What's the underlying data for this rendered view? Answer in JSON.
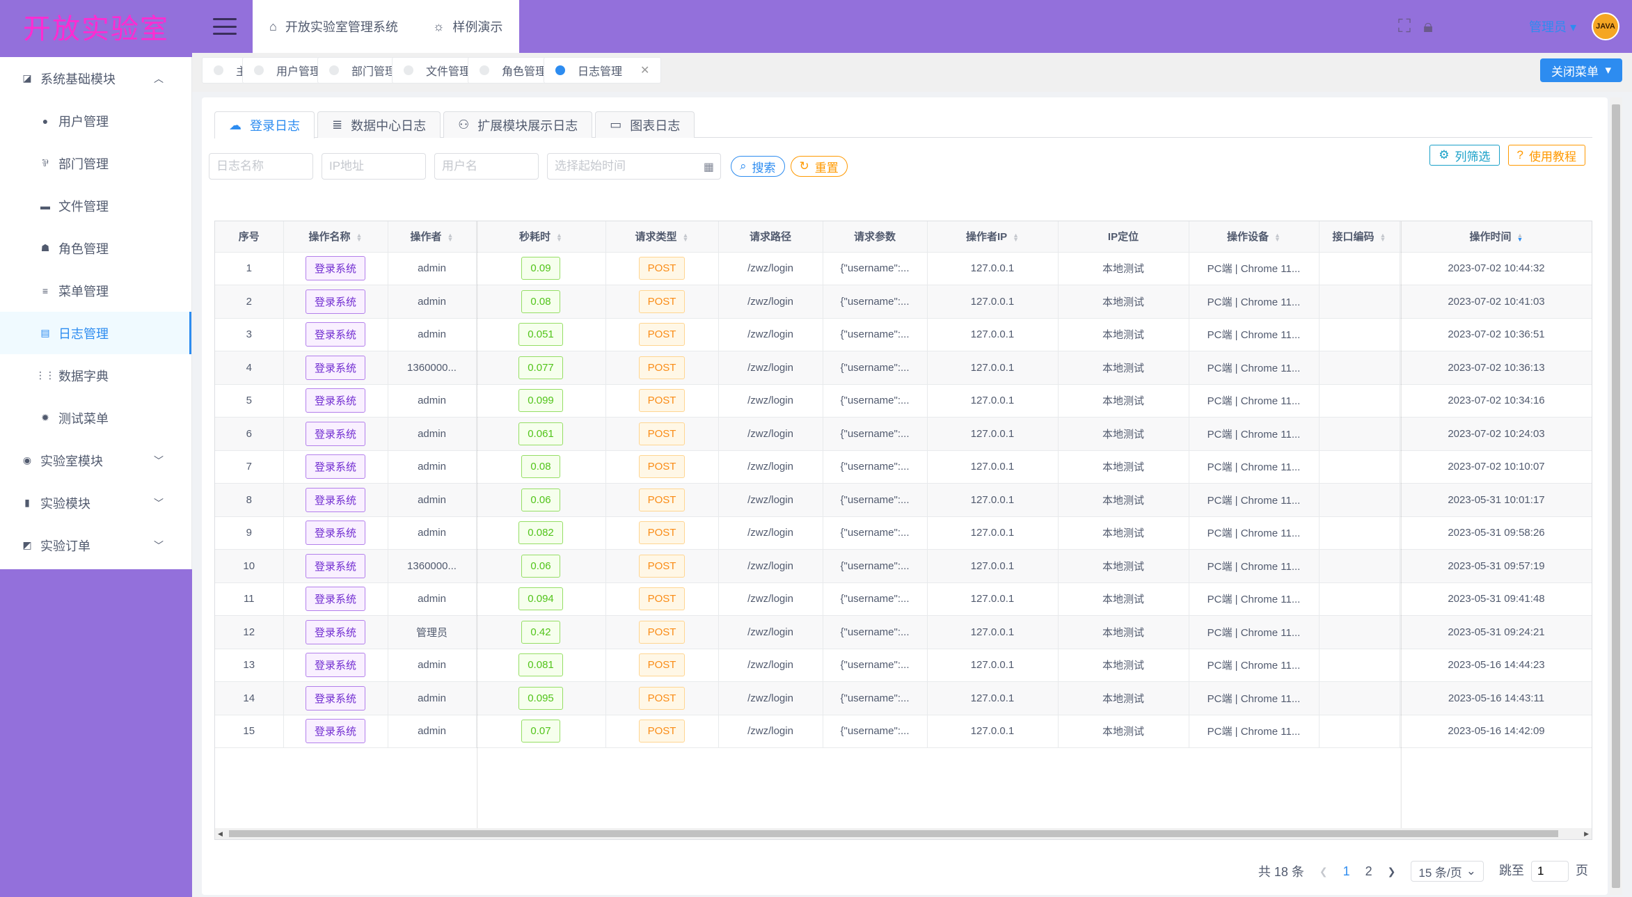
{
  "brand": {
    "logo_text": "开放实验室"
  },
  "header": {
    "nav": [
      {
        "icon": "home-icon",
        "glyph": "⌂",
        "label": "开放实验室管理系统"
      },
      {
        "icon": "bulb-icon",
        "glyph": "☼",
        "label": "样例演示"
      }
    ],
    "username": "管理员",
    "avatar_text": "JAVA"
  },
  "sidebar": {
    "items": [
      {
        "label": "系统基础模块",
        "level": "top",
        "icon": "chart-icon",
        "glyph": "◪",
        "chevron": "︿"
      },
      {
        "label": "用户管理",
        "level": "sub",
        "icon": "user-icon",
        "glyph": "●"
      },
      {
        "label": "部门管理",
        "level": "sub",
        "icon": "department-icon",
        "glyph": "⅌"
      },
      {
        "label": "文件管理",
        "level": "sub",
        "icon": "folder-icon",
        "glyph": "▬"
      },
      {
        "label": "角色管理",
        "level": "sub",
        "icon": "role-icon",
        "glyph": "☗"
      },
      {
        "label": "菜单管理",
        "level": "sub",
        "icon": "menu-icon",
        "glyph": "≡"
      },
      {
        "label": "日志管理",
        "level": "sub",
        "icon": "log-icon",
        "glyph": "▤",
        "active": true
      },
      {
        "label": "数据字典",
        "level": "sub",
        "icon": "grid-icon",
        "glyph": "⋮⋮"
      },
      {
        "label": "测试菜单",
        "level": "sub",
        "icon": "bug-icon",
        "glyph": "✹"
      },
      {
        "label": "实验室模块",
        "level": "top",
        "icon": "lab-icon",
        "glyph": "◉",
        "chevron": "﹀"
      },
      {
        "label": "实验模块",
        "level": "top",
        "icon": "experiment-icon",
        "glyph": "▮",
        "chevron": "﹀"
      },
      {
        "label": "实验订单",
        "level": "top",
        "icon": "order-icon",
        "glyph": "◩",
        "chevron": "﹀"
      }
    ]
  },
  "tags": [
    {
      "label": "主页",
      "closable": false,
      "active": false
    },
    {
      "label": "用户管理",
      "closable": true,
      "active": false
    },
    {
      "label": "部门管理",
      "closable": true,
      "active": false
    },
    {
      "label": "文件管理",
      "closable": true,
      "active": false
    },
    {
      "label": "角色管理",
      "closable": true,
      "active": false
    },
    {
      "label": "日志管理",
      "closable": true,
      "active": true
    }
  ],
  "close_menu_label": "关闭菜单",
  "subtabs": [
    {
      "label": "登录日志",
      "icon": "cloud-upload-icon",
      "glyph": "☁",
      "active": true
    },
    {
      "label": "数据中心日志",
      "icon": "list-icon",
      "glyph": "≣"
    },
    {
      "label": "扩展模块展示日志",
      "icon": "people-icon",
      "glyph": "⚇"
    },
    {
      "label": "图表日志",
      "icon": "monitor-icon",
      "glyph": "▭"
    }
  ],
  "filters": {
    "log_name_placeholder": "日志名称",
    "ip_placeholder": "IP地址",
    "username_placeholder": "用户名",
    "date_placeholder": "选择起始时间",
    "search_label": "搜索",
    "reset_label": "重置"
  },
  "tools": {
    "column_filter_label": "列筛选",
    "tutorial_label": "使用教程"
  },
  "table": {
    "columns": [
      "序号",
      "操作名称",
      "操作者",
      "秒耗时",
      "请求类型",
      "请求路径",
      "请求参数",
      "操作者IP",
      "IP定位",
      "操作设备",
      "接口编码",
      "操作时间"
    ],
    "rows": [
      [
        "1",
        "登录系统",
        "admin",
        "0.09",
        "POST",
        "/zwz/login",
        "{\"username\":...",
        "127.0.0.1",
        "本地测试",
        "PC端 | Chrome 11...",
        "",
        "2023-07-02 10:44:32"
      ],
      [
        "2",
        "登录系统",
        "admin",
        "0.08",
        "POST",
        "/zwz/login",
        "{\"username\":...",
        "127.0.0.1",
        "本地测试",
        "PC端 | Chrome 11...",
        "",
        "2023-07-02 10:41:03"
      ],
      [
        "3",
        "登录系统",
        "admin",
        "0.051",
        "POST",
        "/zwz/login",
        "{\"username\":...",
        "127.0.0.1",
        "本地测试",
        "PC端 | Chrome 11...",
        "",
        "2023-07-02 10:36:51"
      ],
      [
        "4",
        "登录系统",
        "1360000...",
        "0.077",
        "POST",
        "/zwz/login",
        "{\"username\":...",
        "127.0.0.1",
        "本地测试",
        "PC端 | Chrome 11...",
        "",
        "2023-07-02 10:36:13"
      ],
      [
        "5",
        "登录系统",
        "admin",
        "0.099",
        "POST",
        "/zwz/login",
        "{\"username\":...",
        "127.0.0.1",
        "本地测试",
        "PC端 | Chrome 11...",
        "",
        "2023-07-02 10:34:16"
      ],
      [
        "6",
        "登录系统",
        "admin",
        "0.061",
        "POST",
        "/zwz/login",
        "{\"username\":...",
        "127.0.0.1",
        "本地测试",
        "PC端 | Chrome 11...",
        "",
        "2023-07-02 10:24:03"
      ],
      [
        "7",
        "登录系统",
        "admin",
        "0.08",
        "POST",
        "/zwz/login",
        "{\"username\":...",
        "127.0.0.1",
        "本地测试",
        "PC端 | Chrome 11...",
        "",
        "2023-07-02 10:10:07"
      ],
      [
        "8",
        "登录系统",
        "admin",
        "0.06",
        "POST",
        "/zwz/login",
        "{\"username\":...",
        "127.0.0.1",
        "本地测试",
        "PC端 | Chrome 11...",
        "",
        "2023-05-31 10:01:17"
      ],
      [
        "9",
        "登录系统",
        "admin",
        "0.082",
        "POST",
        "/zwz/login",
        "{\"username\":...",
        "127.0.0.1",
        "本地测试",
        "PC端 | Chrome 11...",
        "",
        "2023-05-31 09:58:26"
      ],
      [
        "10",
        "登录系统",
        "1360000...",
        "0.06",
        "POST",
        "/zwz/login",
        "{\"username\":...",
        "127.0.0.1",
        "本地测试",
        "PC端 | Chrome 11...",
        "",
        "2023-05-31 09:57:19"
      ],
      [
        "11",
        "登录系统",
        "admin",
        "0.094",
        "POST",
        "/zwz/login",
        "{\"username\":...",
        "127.0.0.1",
        "本地测试",
        "PC端 | Chrome 11...",
        "",
        "2023-05-31 09:41:48"
      ],
      [
        "12",
        "登录系统",
        "管理员",
        "0.42",
        "POST",
        "/zwz/login",
        "{\"username\":...",
        "127.0.0.1",
        "本地测试",
        "PC端 | Chrome 11...",
        "",
        "2023-05-31 09:24:21"
      ],
      [
        "13",
        "登录系统",
        "admin",
        "0.081",
        "POST",
        "/zwz/login",
        "{\"username\":...",
        "127.0.0.1",
        "本地测试",
        "PC端 | Chrome 11...",
        "",
        "2023-05-16 14:44:23"
      ],
      [
        "14",
        "登录系统",
        "admin",
        "0.095",
        "POST",
        "/zwz/login",
        "{\"username\":...",
        "127.0.0.1",
        "本地测试",
        "PC端 | Chrome 11...",
        "",
        "2023-05-16 14:43:11"
      ],
      [
        "15",
        "登录系统",
        "admin",
        "0.07",
        "POST",
        "/zwz/login",
        "{\"username\":...",
        "127.0.0.1",
        "本地测试",
        "PC端 | Chrome 11...",
        "",
        "2023-05-16 14:42:09"
      ]
    ]
  },
  "pagination": {
    "total_label": "共 18 条",
    "pages": [
      "1",
      "2"
    ],
    "current": "1",
    "page_size_label": "15 条/页",
    "jump_label": "跳至",
    "jump_value": "1",
    "page_suffix": "页"
  },
  "colors": {
    "primary": "#2d8cf0",
    "sidebar": "#9370db",
    "warning": "#ff9900",
    "logo": "#ff2bd1"
  }
}
